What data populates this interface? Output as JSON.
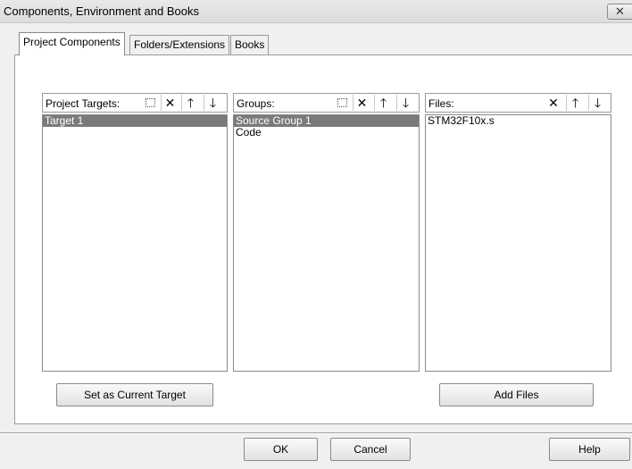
{
  "window": {
    "title": "Components, Environment and Books",
    "close_label": "✕"
  },
  "tabs": [
    {
      "label": "Project Components"
    },
    {
      "label": "Folders/Extensions"
    },
    {
      "label": "Books"
    }
  ],
  "panels": {
    "targets": {
      "label": "Project Targets:",
      "items": [
        "Target 1"
      ]
    },
    "groups": {
      "label": "Groups:",
      "items": [
        "Source Group 1",
        "Code"
      ]
    },
    "files": {
      "label": "Files:",
      "items": [
        "STM32F10x.s"
      ]
    }
  },
  "buttons": {
    "set_current_target": "Set as Current Target",
    "add_files": "Add Files",
    "ok": "OK",
    "cancel": "Cancel",
    "help": "Help"
  },
  "icons": {
    "new": "new-icon",
    "delete": "delete-icon",
    "move_up": "arrow-up-icon",
    "move_down": "arrow-down-icon"
  }
}
